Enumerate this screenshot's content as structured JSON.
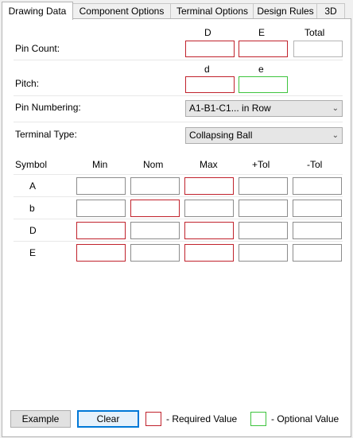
{
  "tabs": [
    "Drawing Data",
    "Component Options",
    "Terminal Options",
    "Design Rules",
    "3D"
  ],
  "pin_count": {
    "label": "Pin Count:",
    "col_d": "D",
    "col_e": "E",
    "col_total": "Total"
  },
  "pitch": {
    "label": "Pitch:",
    "col_d": "d",
    "col_e": "e"
  },
  "pin_numbering": {
    "label": "Pin Numbering:",
    "value": "A1-B1-C1... in Row"
  },
  "terminal_type": {
    "label": "Terminal Type:",
    "value": "Collapsing Ball"
  },
  "table": {
    "headers": [
      "Symbol",
      "Min",
      "Nom",
      "Max",
      "+Tol",
      "-Tol"
    ],
    "rows": [
      {
        "symbol": "A"
      },
      {
        "symbol": "b"
      },
      {
        "symbol": "D"
      },
      {
        "symbol": "E"
      }
    ]
  },
  "buttons": {
    "example": "Example",
    "clear": "Clear"
  },
  "legend": {
    "required": "- Required Value",
    "optional": "- Optional Value"
  },
  "colors": {
    "required": "#c0222c",
    "optional": "#3ec43e",
    "focus": "#0078d7"
  }
}
